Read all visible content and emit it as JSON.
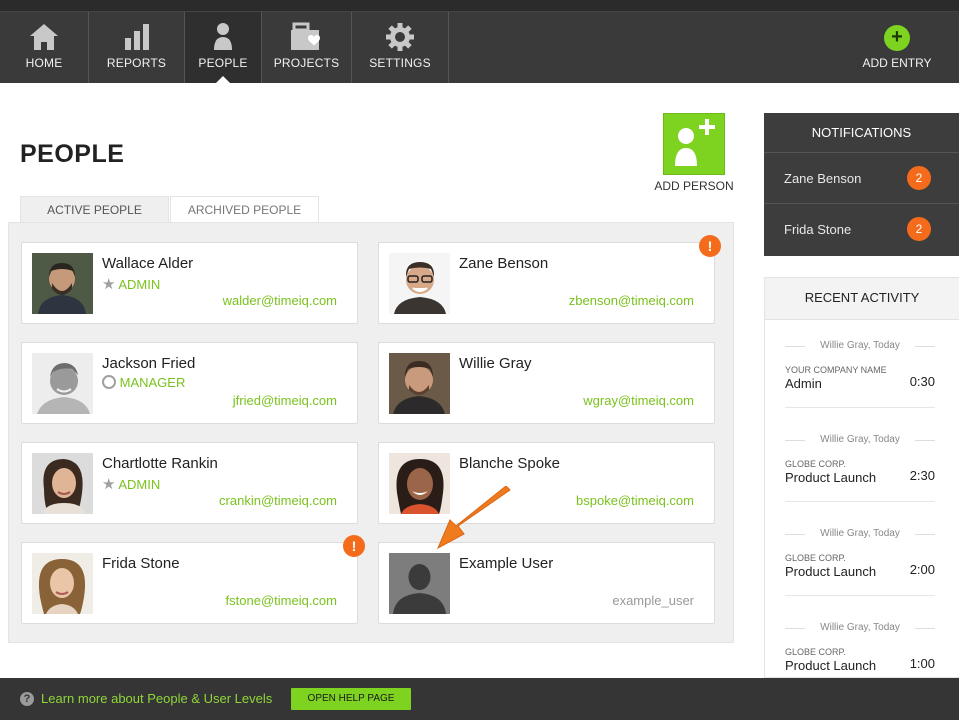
{
  "nav": {
    "items": [
      {
        "label": "HOME",
        "icon": "home-icon"
      },
      {
        "label": "REPORTS",
        "icon": "bar-chart-icon"
      },
      {
        "label": "PEOPLE",
        "icon": "person-icon"
      },
      {
        "label": "PROJECTS",
        "icon": "briefcase-heart-icon"
      },
      {
        "label": "SETTINGS",
        "icon": "gear-icon"
      }
    ],
    "active": "PEOPLE",
    "add_entry_label": "ADD ENTRY"
  },
  "page": {
    "title": "PEOPLE",
    "add_person_label": "ADD PERSON"
  },
  "tabs": {
    "active": "ACTIVE PEOPLE",
    "archived": "ARCHIVED PEOPLE"
  },
  "people": [
    {
      "name": "Wallace Alder",
      "role": "ADMIN",
      "email": "walder@timeiq.com"
    },
    {
      "name": "Zane Benson",
      "role": "",
      "email": "zbenson@timeiq.com",
      "alert": "!"
    },
    {
      "name": "Jackson Fried",
      "role": "MANAGER",
      "email": "jfried@timeiq.com"
    },
    {
      "name": "Willie Gray",
      "role": "",
      "email": "wgray@timeiq.com"
    },
    {
      "name": "Chartlotte Rankin",
      "role": "ADMIN",
      "email": "crankin@timeiq.com"
    },
    {
      "name": "Blanche Spoke",
      "role": "",
      "email": "bspoke@timeiq.com"
    },
    {
      "name": "Frida Stone",
      "role": "",
      "email": "fstone@timeiq.com",
      "alert": "!"
    },
    {
      "name": "Example User",
      "role": "",
      "email": "example_user"
    }
  ],
  "notifications": {
    "title": "NOTIFICATIONS",
    "items": [
      {
        "name": "Zane Benson",
        "count": "2"
      },
      {
        "name": "Frida Stone",
        "count": "2"
      }
    ]
  },
  "recent_activity": {
    "title": "RECENT ACTIVITY",
    "items": [
      {
        "who": "Willie Gray, Today",
        "company": "YOUR COMPANY NAME",
        "project": "Admin",
        "time": "0:30"
      },
      {
        "who": "Willie Gray, Today",
        "company": "GLOBE CORP.",
        "project": "Product Launch",
        "time": "2:30"
      },
      {
        "who": "Willie Gray, Today",
        "company": "GLOBE CORP.",
        "project": "Product Launch",
        "time": "2:00"
      },
      {
        "who": "Willie Gray, Today",
        "company": "GLOBE CORP.",
        "project": "Product Launch",
        "time": "1:00"
      }
    ]
  },
  "footer": {
    "help_icon": "?",
    "text": "Learn more about People & User Levels",
    "button": "OPEN HELP PAGE"
  },
  "colors": {
    "accent": "#7ed321",
    "alert": "#f46b1b",
    "navbar": "#3a3a3a"
  }
}
